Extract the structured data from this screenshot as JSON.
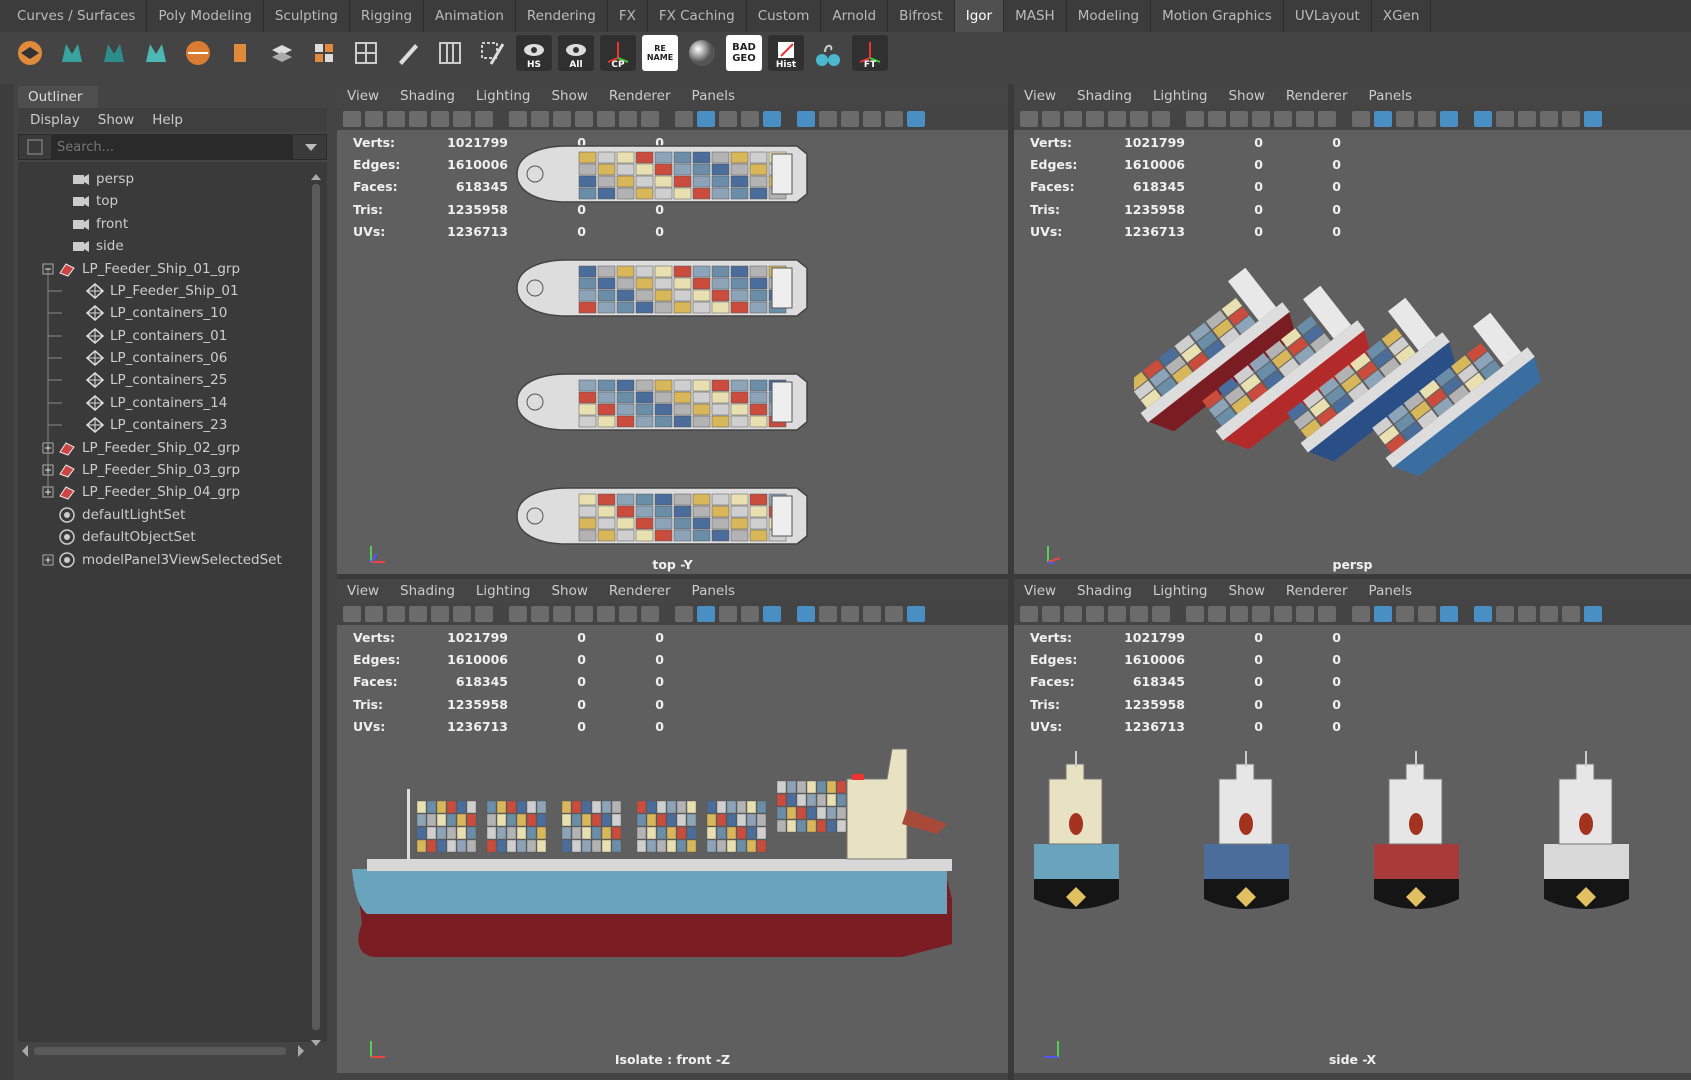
{
  "shelf": {
    "tabs": [
      "Curves / Surfaces",
      "Poly Modeling",
      "Sculpting",
      "Rigging",
      "Animation",
      "Rendering",
      "FX",
      "FX Caching",
      "Custom",
      "Arnold",
      "Bifrost",
      "Igor",
      "MASH",
      "Modeling",
      "Motion Graphics",
      "UVLayout",
      "XGen"
    ],
    "active_tab": "Igor",
    "button_labels": {
      "hs": "HS",
      "all": "All",
      "cp": "CP",
      "rename": "RE NAME",
      "badgeo": "BAD GEO",
      "hist": "Hist",
      "ft": "FT"
    }
  },
  "outliner": {
    "title": "Outliner",
    "menu": [
      "Display",
      "Show",
      "Help"
    ],
    "search_placeholder": "Search...",
    "items": [
      {
        "label": "persp",
        "icon": "camera-icon"
      },
      {
        "label": "top",
        "icon": "camera-icon"
      },
      {
        "label": "front",
        "icon": "camera-icon"
      },
      {
        "label": "side",
        "icon": "camera-icon"
      },
      {
        "label": "LP_Feeder_Ship_01_grp",
        "icon": "group-icon",
        "expanded": true
      },
      {
        "label": "LP_Feeder_Ship_01",
        "icon": "mesh-icon"
      },
      {
        "label": "LP_containers_10",
        "icon": "mesh-icon"
      },
      {
        "label": "LP_containers_01",
        "icon": "mesh-icon"
      },
      {
        "label": "LP_containers_06",
        "icon": "mesh-icon"
      },
      {
        "label": "LP_containers_25",
        "icon": "mesh-icon"
      },
      {
        "label": "LP_containers_14",
        "icon": "mesh-icon"
      },
      {
        "label": "LP_containers_23",
        "icon": "mesh-icon"
      },
      {
        "label": "LP_Feeder_Ship_02_grp",
        "icon": "group-icon",
        "expanded": false
      },
      {
        "label": "LP_Feeder_Ship_03_grp",
        "icon": "group-icon",
        "expanded": false
      },
      {
        "label": "LP_Feeder_Ship_04_grp",
        "icon": "group-icon",
        "expanded": false
      },
      {
        "label": "defaultLightSet",
        "icon": "set-icon"
      },
      {
        "label": "defaultObjectSet",
        "icon": "set-icon"
      },
      {
        "label": "modelPanel3ViewSelectedSet",
        "icon": "set-icon",
        "expanded": false
      }
    ]
  },
  "viewport_menu": [
    "View",
    "Shading",
    "Lighting",
    "Show",
    "Renderer",
    "Panels"
  ],
  "hud": {
    "labels": [
      "Verts:",
      "Edges:",
      "Faces:",
      "Tris:",
      "UVs:"
    ],
    "values": [
      "1021799",
      "1610006",
      "618345",
      "1235958",
      "1236713"
    ],
    "zero": "0"
  },
  "viewports": {
    "top": {
      "caption": "top -Y"
    },
    "persp": {
      "caption": "persp"
    },
    "front": {
      "caption": "Isolate : front -Z"
    },
    "side": {
      "caption": "side -X"
    }
  },
  "colors": {
    "accent": "#4a8fc4",
    "hull_red": "#7a1d22",
    "hull_blue": "#6aa4bc",
    "deck": "#e8e1c2"
  }
}
